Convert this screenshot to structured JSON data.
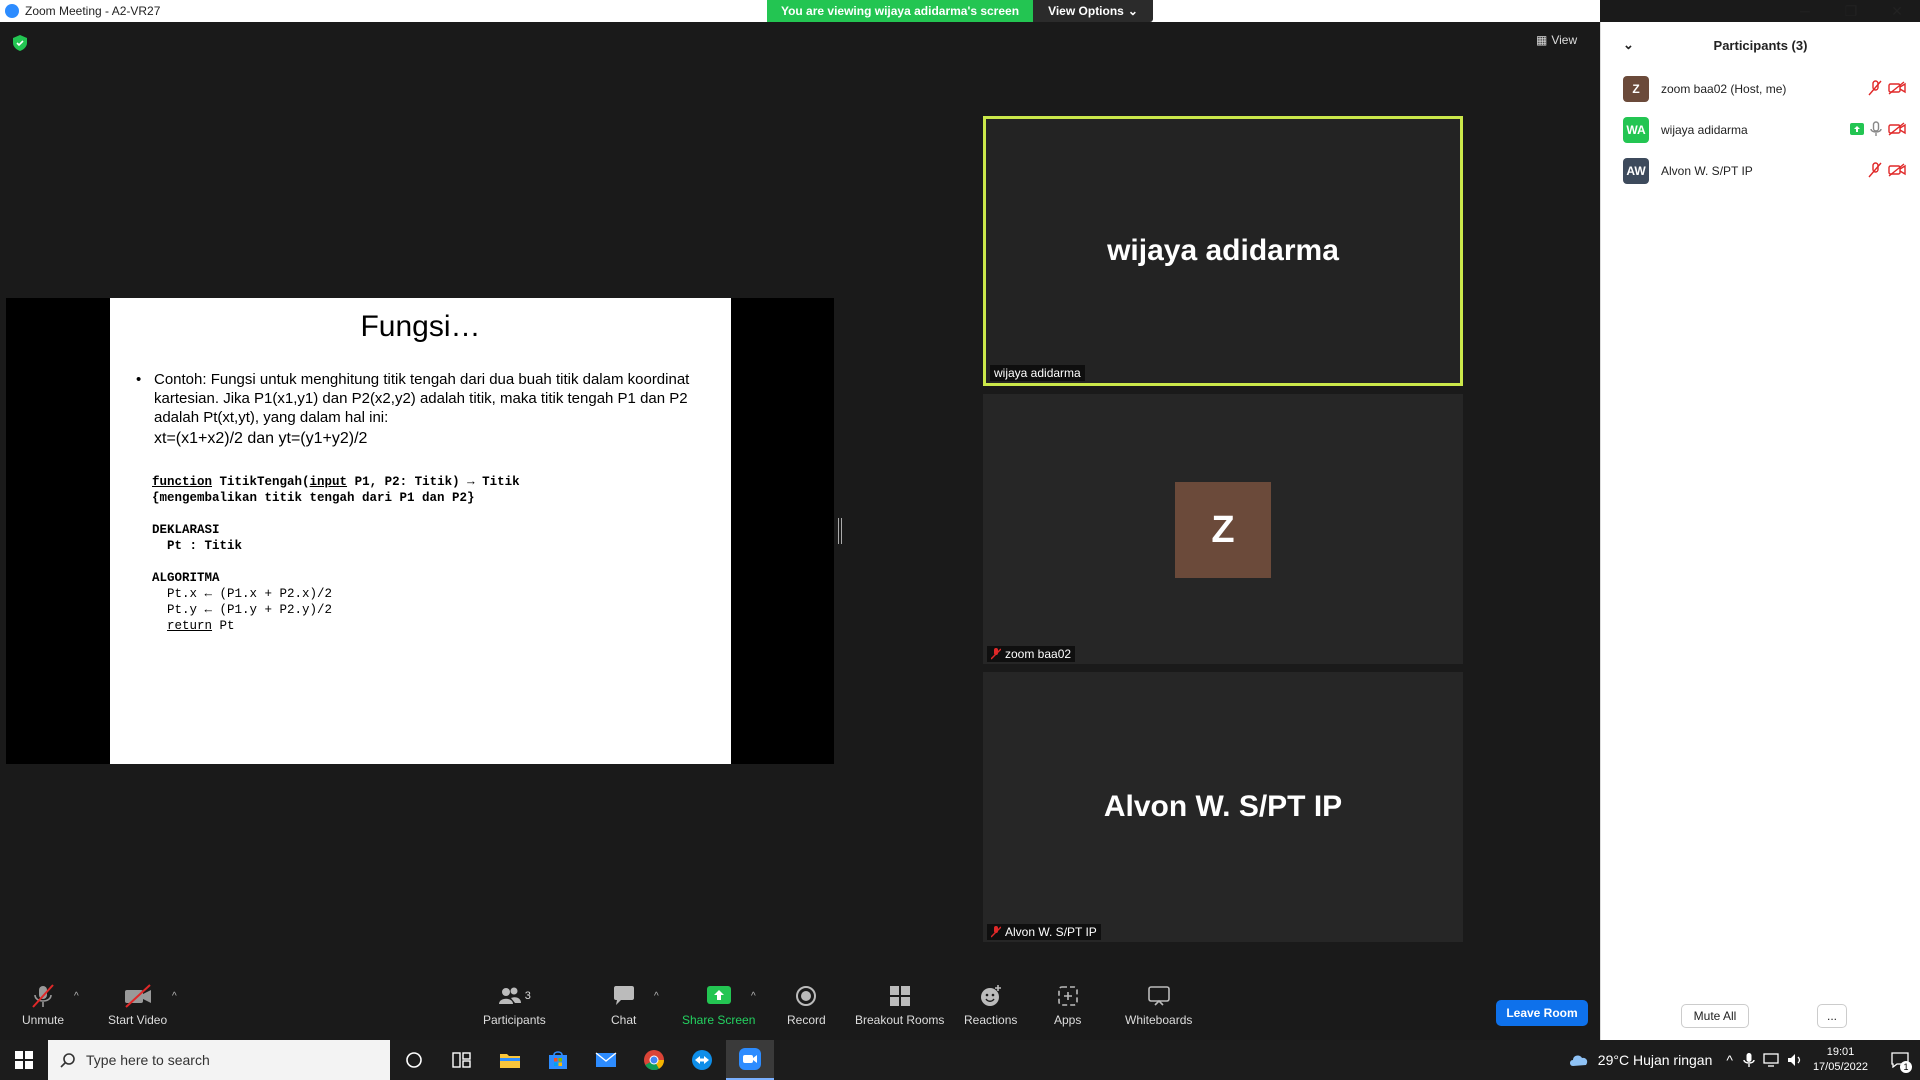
{
  "window": {
    "title": "Zoom Meeting - A2-VR27"
  },
  "banner": {
    "viewing": "You are viewing wijaya adidarma's screen",
    "view_options": "View Options"
  },
  "main": {
    "view_label": "View"
  },
  "slide": {
    "title": "Fungsi…",
    "bullet": "Contoh: Fungsi untuk menghitung titik tengah dari dua buah titik dalam koordinat kartesian. Jika P1(x1,y1) dan P2(x2,y2) adalah titik, maka titik tengah P1 dan P2 adalah Pt(xt,yt), yang dalam hal ini:",
    "formula": "xt=(x1+x2)/2 dan yt=(y1+y2)/2",
    "code": {
      "kw_function": "function",
      "fn_sig_a": " TitikTengah(",
      "kw_input": "input",
      "fn_sig_b": " P1, P2: Titik) → Titik",
      "comment": "{mengembalikan titik tengah dari P1 dan P2}",
      "deklarasi": "DEKLARASI",
      "decl_pt": "  Pt : Titik",
      "algoritma": "ALGORITMA",
      "line_x": "  Pt.x ← (P1.x + P2.x)/2",
      "line_y": "  Pt.y ← (P1.y + P2.y)/2",
      "kw_return": "return",
      "ret_val": " Pt"
    }
  },
  "tiles": [
    {
      "big_name": "wijaya adidarma",
      "label": "wijaya adidarma"
    },
    {
      "avatar": "Z",
      "label": "zoom baa02"
    },
    {
      "big_name": "Alvon W. S/PT IP",
      "label": "Alvon W. S/PT IP"
    }
  ],
  "participants_panel": {
    "title": "Participants (3)",
    "participants": [
      {
        "initials": "Z",
        "name": "zoom baa02 (Host, me)",
        "color": "#6b4a3a"
      },
      {
        "initials": "WA",
        "name": "wijaya adidarma",
        "color": "#23c552"
      },
      {
        "initials": "AW",
        "name": "Alvon W. S/PT IP",
        "color": "#3d4a5c"
      }
    ],
    "mute_all": "Mute All",
    "more": "..."
  },
  "toolbar": {
    "unmute": "Unmute",
    "start_video": "Start Video",
    "participants": "Participants",
    "participants_count": "3",
    "chat": "Chat",
    "share_screen": "Share Screen",
    "record": "Record",
    "breakout_rooms": "Breakout Rooms",
    "reactions": "Reactions",
    "apps": "Apps",
    "whiteboards": "Whiteboards",
    "leave": "Leave Room"
  },
  "taskbar": {
    "search_placeholder": "Type here to search",
    "weather": "29°C  Hujan ringan",
    "time": "19:01",
    "date": "17/05/2022",
    "notif_count": "1"
  }
}
